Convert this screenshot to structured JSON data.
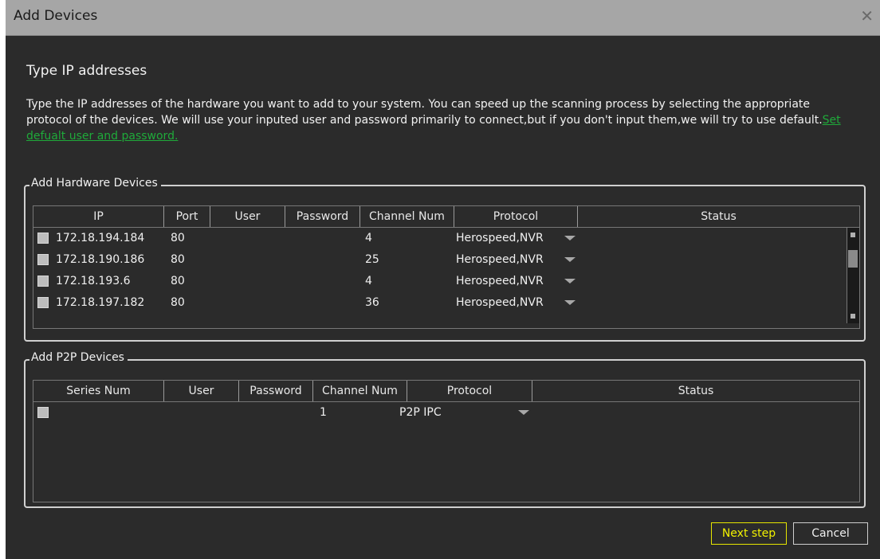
{
  "window": {
    "title": "Add Devices",
    "close_glyph": "✕"
  },
  "heading": "Type IP addresses",
  "description": {
    "text": "Type the IP addresses of the hardware you want to add to your system. You can speed up the scanning process by selecting the appropriate protocol of the devices. We will use your inputed user and password primarily to connect,but if you don't input them,we will try to use default.",
    "link": "Set defualt user and password."
  },
  "hardware": {
    "legend": "Add Hardware Devices",
    "columns": [
      "IP",
      "Port",
      "User",
      "Password",
      "Channel Num",
      "Protocol",
      "Status"
    ],
    "rows": [
      {
        "ip": "172.18.194.184",
        "port": "80",
        "user": "",
        "password": "",
        "channels": "4",
        "protocol": "Herospeed,NVR",
        "status": ""
      },
      {
        "ip": "172.18.190.186",
        "port": "80",
        "user": "",
        "password": "",
        "channels": "25",
        "protocol": "Herospeed,NVR",
        "status": ""
      },
      {
        "ip": "172.18.193.6",
        "port": "80",
        "user": "",
        "password": "",
        "channels": "4",
        "protocol": "Herospeed,NVR",
        "status": ""
      },
      {
        "ip": "172.18.197.182",
        "port": "80",
        "user": "",
        "password": "",
        "channels": "36",
        "protocol": "Herospeed,NVR",
        "status": ""
      }
    ]
  },
  "p2p": {
    "legend": "Add P2P Devices",
    "columns": [
      "Series Num",
      "User",
      "Password",
      "Channel Num",
      "Protocol",
      "Status"
    ],
    "rows": [
      {
        "series": "",
        "user": "",
        "password": "",
        "channels": "1",
        "protocol": "P2P IPC",
        "status": ""
      }
    ]
  },
  "buttons": {
    "next": "Next step",
    "cancel": "Cancel"
  },
  "colors": {
    "accent_next": "#f2f200",
    "link": "#1faa3a",
    "background": "#2b2b2b"
  }
}
